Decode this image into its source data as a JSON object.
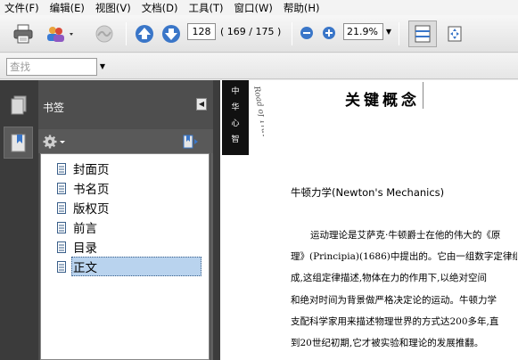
{
  "menubar": {
    "items": [
      "文件(F)",
      "编辑(E)",
      "视图(V)",
      "文档(D)",
      "工具(T)",
      "窗口(W)",
      "帮助(H)"
    ]
  },
  "toolbar": {
    "page_number": "128",
    "page_count": "( 169 ∕ 175 )",
    "zoom": "21.9%"
  },
  "find": {
    "placeholder": "查找"
  },
  "bookmarks": {
    "title": "书签",
    "items": [
      "封面页",
      "书名页",
      "版权页",
      "前言",
      "目录",
      "正文"
    ],
    "selected_index": 5
  },
  "document": {
    "strip_chars": [
      "中",
      "华",
      "心",
      "智"
    ],
    "italic_text": "Road of Trav",
    "chapter_title": "关键概念",
    "section_title": "牛顿力学(Newton's Mechanics)",
    "paragraph_lines": [
      "运动理论是艾萨克·牛顿爵士在他的伟大的《原",
      "理》(Principia)(1686)中提出的。它由一组数字定律组",
      "成,这组定律描述,物体在力的作用下,以绝对空间",
      "和绝对时间为背景做严格决定论的运动。牛顿力学",
      "支配科学家用来描述物理世界的方式达200多年,直",
      "到20世纪初期,它才被实验和理论的发展推翻。"
    ]
  },
  "colors": {
    "panel_dark": "#3b3b3b",
    "selection": "#b9d3ee",
    "nav_arrow": "#3a76c8"
  }
}
